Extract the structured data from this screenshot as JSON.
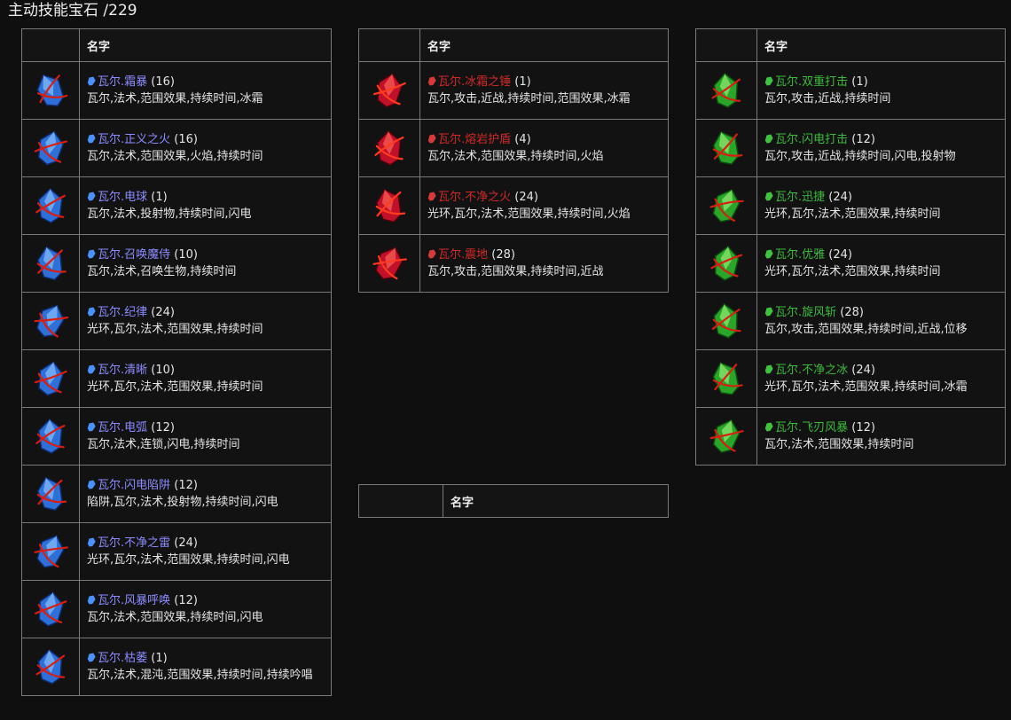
{
  "page": {
    "title": "主动技能宝石 /229"
  },
  "tables": [
    {
      "header": "名字",
      "color": "blue",
      "rows": [
        {
          "name": "瓦尔.霜暴",
          "level": "(16)",
          "tags": "瓦尔,法术,范围效果,持续时间,冰霜",
          "icon": "frost-storm-gem-icon"
        },
        {
          "name": "瓦尔.正义之火",
          "level": "(16)",
          "tags": "瓦尔,法术,范围效果,火焰,持续时间",
          "icon": "righteous-fire-gem-icon"
        },
        {
          "name": "瓦尔.电球",
          "level": "(1)",
          "tags": "瓦尔,法术,投射物,持续时间,闪电",
          "icon": "ball-lightning-gem-icon"
        },
        {
          "name": "瓦尔.召唤魔侍",
          "level": "(10)",
          "tags": "瓦尔,法术,召唤生物,持续时间",
          "icon": "summon-phantasm-gem-icon"
        },
        {
          "name": "瓦尔.纪律",
          "level": "(24)",
          "tags": "光环,瓦尔,法术,范围效果,持续时间",
          "icon": "discipline-gem-icon"
        },
        {
          "name": "瓦尔.清晰",
          "level": "(10)",
          "tags": "光环,瓦尔,法术,范围效果,持续时间",
          "icon": "clarity-gem-icon"
        },
        {
          "name": "瓦尔.电弧",
          "level": "(12)",
          "tags": "瓦尔,法术,连锁,闪电,持续时间",
          "icon": "arc-gem-icon"
        },
        {
          "name": "瓦尔.闪电陷阱",
          "level": "(12)",
          "tags": "陷阱,瓦尔,法术,投射物,持续时间,闪电",
          "icon": "lightning-trap-gem-icon"
        },
        {
          "name": "瓦尔.不净之雷",
          "level": "(24)",
          "tags": "光环,瓦尔,法术,范围效果,持续时间,闪电",
          "icon": "impurity-of-lightning-gem-icon"
        },
        {
          "name": "瓦尔.风暴呼唤",
          "level": "(12)",
          "tags": "瓦尔,法术,范围效果,持续时间,闪电",
          "icon": "storm-call-gem-icon"
        },
        {
          "name": "瓦尔.枯萎",
          "level": "(1)",
          "tags": "瓦尔,法术,混沌,范围效果,持续时间,持续吟唱",
          "icon": "blight-gem-icon"
        }
      ]
    },
    {
      "header": "名字",
      "color": "red",
      "rows": [
        {
          "name": "瓦尔.冰霜之锤",
          "level": "(1)",
          "tags": "瓦尔,攻击,近战,持续时间,范围效果,冰霜",
          "icon": "glacial-hammer-gem-icon"
        },
        {
          "name": "瓦尔.熔岩护盾",
          "level": "(4)",
          "tags": "瓦尔,法术,范围效果,持续时间,火焰",
          "icon": "molten-shell-gem-icon"
        },
        {
          "name": "瓦尔.不净之火",
          "level": "(24)",
          "tags": "光环,瓦尔,法术,范围效果,持续时间,火焰",
          "icon": "impurity-of-fire-gem-icon"
        },
        {
          "name": "瓦尔.震地",
          "level": "(28)",
          "tags": "瓦尔,攻击,范围效果,持续时间,近战",
          "icon": "ground-slam-gem-icon"
        }
      ]
    },
    {
      "header": "名字",
      "color": "green",
      "rows": [
        {
          "name": "瓦尔.双重打击",
          "level": "(1)",
          "tags": "瓦尔,攻击,近战,持续时间",
          "icon": "double-strike-gem-icon"
        },
        {
          "name": "瓦尔.闪电打击",
          "level": "(12)",
          "tags": "瓦尔,攻击,近战,持续时间,闪电,投射物",
          "icon": "lightning-strike-gem-icon"
        },
        {
          "name": "瓦尔.迅捷",
          "level": "(24)",
          "tags": "光环,瓦尔,法术,范围效果,持续时间",
          "icon": "haste-gem-icon"
        },
        {
          "name": "瓦尔.优雅",
          "level": "(24)",
          "tags": "光环,瓦尔,法术,范围效果,持续时间",
          "icon": "grace-gem-icon"
        },
        {
          "name": "瓦尔.旋风斩",
          "level": "(28)",
          "tags": "瓦尔,攻击,范围效果,持续时间,近战,位移",
          "icon": "cyclone-gem-icon"
        },
        {
          "name": "瓦尔.不净之冰",
          "level": "(24)",
          "tags": "光环,瓦尔,法术,范围效果,持续时间,冰霜",
          "icon": "impurity-of-ice-gem-icon"
        },
        {
          "name": "瓦尔.飞刃风暴",
          "level": "(12)",
          "tags": "瓦尔,法术,范围效果,持续时间",
          "icon": "blade-vortex-gem-icon"
        }
      ]
    },
    {
      "header": "名字",
      "color": "none",
      "rows": []
    }
  ],
  "colors": {
    "blue": "#8c8cff",
    "red": "#d12a2a",
    "green": "#3db93d",
    "border": "#7a7a7a",
    "background": "#0f0f0f"
  }
}
